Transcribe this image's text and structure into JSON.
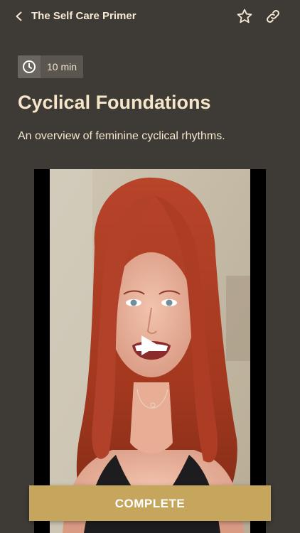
{
  "header": {
    "title": "The Self Care Primer",
    "back_icon": "chevron-left-icon",
    "favorite_icon": "star-icon",
    "share_icon": "link-icon"
  },
  "lesson": {
    "duration_icon": "clock-icon",
    "duration": "10 min",
    "title": "Cyclical Foundations",
    "subtitle": "An overview of feminine cyclical rhythms."
  },
  "video": {
    "play_icon": "play-icon",
    "description_alt": "Video preview of a smiling woman with long red hair"
  },
  "actions": {
    "complete_label": "COMPLETE"
  },
  "colors": {
    "background": "#3e3a35",
    "accent": "#c6a55d",
    "text": "#f3e6cf"
  }
}
